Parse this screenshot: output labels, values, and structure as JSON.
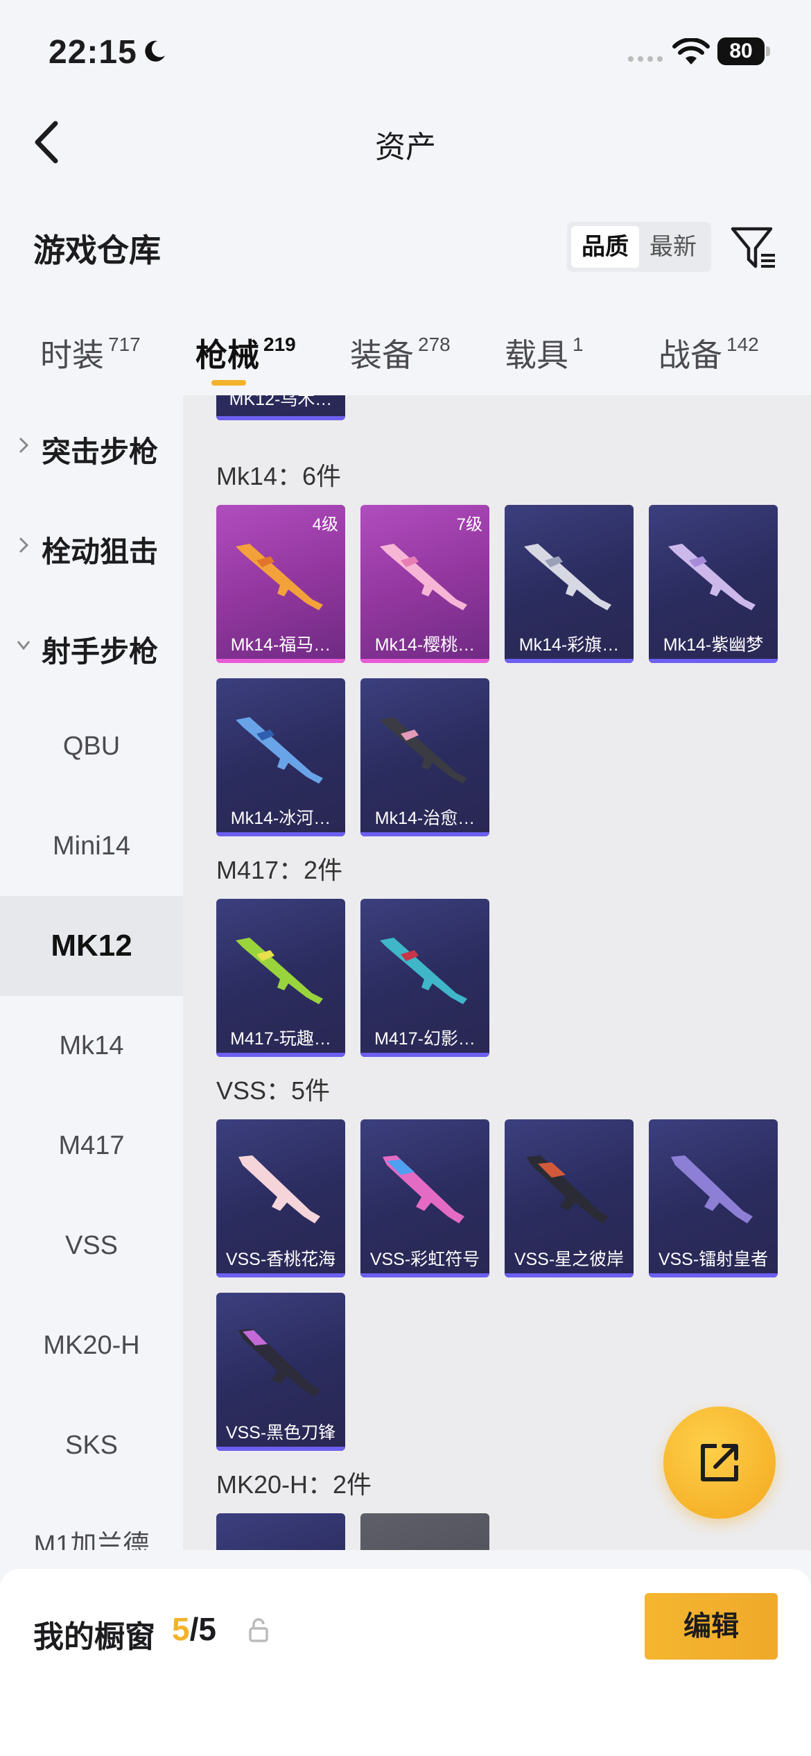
{
  "status_bar": {
    "time": "22:15",
    "battery": "80"
  },
  "nav": {
    "title": "资产"
  },
  "header": {
    "title": "游戏仓库",
    "sort_quality": "品质",
    "sort_latest": "最新"
  },
  "tabs": [
    {
      "label": "时装",
      "count": "717"
    },
    {
      "label": "枪械",
      "count": "219"
    },
    {
      "label": "装备",
      "count": "278"
    },
    {
      "label": "载具",
      "count": "1"
    },
    {
      "label": "战备",
      "count": "142"
    }
  ],
  "sidebar": {
    "groups": [
      "突击步枪",
      "栓动狙击",
      "射手步枪"
    ],
    "items": [
      "QBU",
      "Mini14",
      "MK12",
      "Mk14",
      "M417",
      "VSS",
      "MK20-H",
      "SKS",
      "M1加兰德"
    ]
  },
  "content": {
    "top_card": "MK12-乌木…",
    "groups": [
      {
        "title": "Mk14：6件",
        "cards": [
          {
            "name": "Mk14-福马…",
            "level": "4级"
          },
          {
            "name": "Mk14-樱桃…",
            "level": "7级"
          },
          {
            "name": "Mk14-彩旗…"
          },
          {
            "name": "Mk14-紫幽梦"
          },
          {
            "name": "Mk14-冰河…"
          },
          {
            "name": "Mk14-治愈…"
          }
        ]
      },
      {
        "title": "M417：2件",
        "cards": [
          {
            "name": "M417-玩趣…"
          },
          {
            "name": "M417-幻影…"
          }
        ]
      },
      {
        "title": "VSS：5件",
        "cards": [
          {
            "name": "VSS-香桃花海"
          },
          {
            "name": "VSS-彩虹符号"
          },
          {
            "name": "VSS-星之彼岸"
          },
          {
            "name": "VSS-镭射皇者"
          },
          {
            "name": "VSS-黑色刀锋"
          }
        ]
      },
      {
        "title": "MK20-H：2件",
        "cards": []
      }
    ]
  },
  "bottom": {
    "label": "我的橱窗",
    "current": "5",
    "total": "/5",
    "edit": "编辑"
  },
  "colors": {
    "accent": "#f2b22b",
    "card_blue": "#2b2c5f",
    "card_pink": "#93379f"
  }
}
